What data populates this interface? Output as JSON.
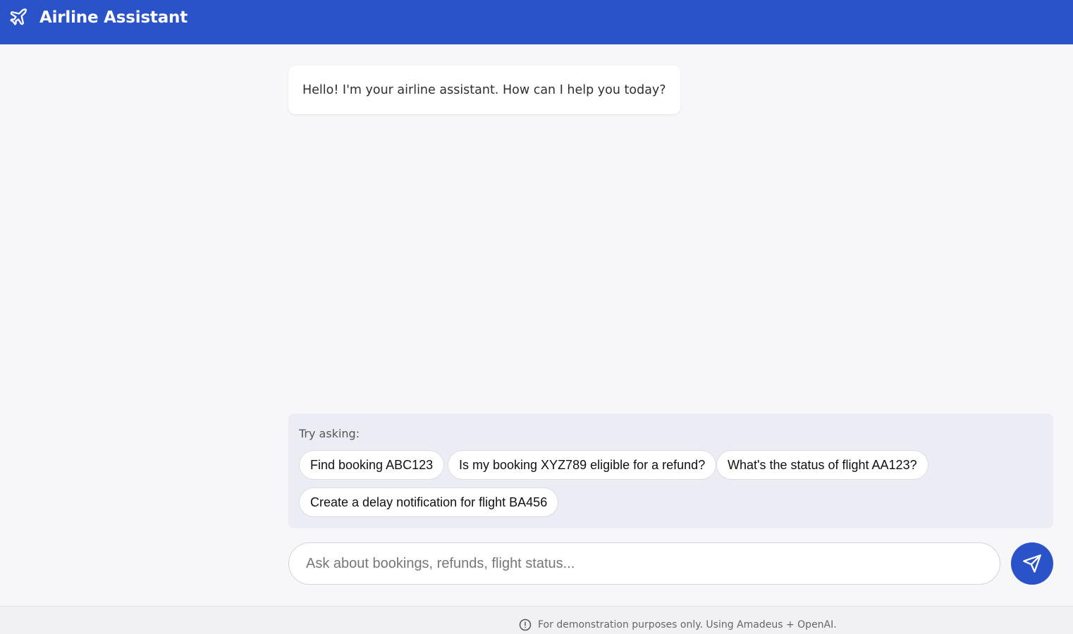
{
  "header": {
    "title": "Airline Assistant",
    "icon": "plane-icon",
    "background_color": "#2b53c9"
  },
  "messages": [
    {
      "role": "assistant",
      "text": "Hello! I'm your airline assistant. How can I help you today?"
    }
  ],
  "suggestions": {
    "label": "Try asking:",
    "chips": [
      "Find booking ABC123",
      "Is my booking XYZ789 eligible for a refund?",
      "What's the status of flight AA123?",
      "Create a delay notification for flight BA456"
    ]
  },
  "composer": {
    "placeholder": "Ask about bookings, refunds, flight status...",
    "value": "",
    "send_icon": "send-icon"
  },
  "footer": {
    "text": "For demonstration purposes only. Using Amadeus + OpenAI.",
    "icon": "info-icon"
  }
}
